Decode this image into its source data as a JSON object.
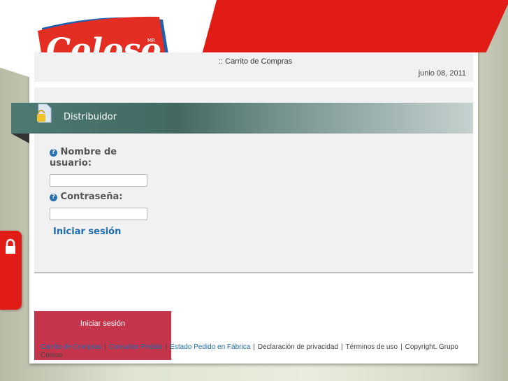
{
  "brand": {
    "logo_text": "Coloso",
    "logo_mark": "MR"
  },
  "header": {
    "breadcrumb": ":: Carrito de Compras",
    "date": "junio 08, 2011"
  },
  "login": {
    "title": "Distribuidor",
    "username_label": "Nombre de usuario:",
    "password_label": "Contraseña:",
    "username_value": "",
    "password_value": "",
    "submit_label": "Iniciar sesión"
  },
  "overlay": {
    "label": "Iniciar sesión"
  },
  "footer": {
    "links": [
      "Carrito de Compras",
      "Consultar Pedido",
      "Estado Pedido en Fábrica"
    ],
    "texts": [
      "Declaración de privacidad",
      "Términos de uso",
      "Copyright. Grupo Coloso"
    ],
    "separator": "|"
  },
  "colors": {
    "brand_red": "#e11c17",
    "teal": "#436862",
    "link": "#1d6bb0",
    "overlay": "#c4344b"
  }
}
